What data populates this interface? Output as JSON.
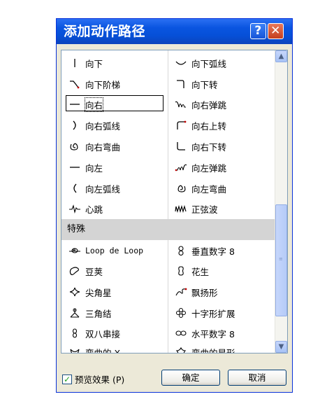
{
  "window": {
    "title": "添加动作路径",
    "help_symbol": "?",
    "close_symbol": "✕"
  },
  "list": {
    "basic_left": [
      {
        "label": "向下",
        "icon": "line-down-icon"
      },
      {
        "label": "向下阶梯",
        "icon": "step-down-icon"
      },
      {
        "label": "向右",
        "icon": "line-right-icon",
        "selected": true
      },
      {
        "label": "向右弧线",
        "icon": "arc-right-icon"
      },
      {
        "label": "向右弯曲",
        "icon": "curve-right-icon"
      },
      {
        "label": "向左",
        "icon": "line-left-icon"
      },
      {
        "label": "向左弧线",
        "icon": "arc-left-icon"
      },
      {
        "label": "心跳",
        "icon": "heartbeat-icon"
      }
    ],
    "basic_right": [
      {
        "label": "向下弧线",
        "icon": "arc-down-icon"
      },
      {
        "label": "向下转",
        "icon": "turn-down-icon"
      },
      {
        "label": "向右弹跳",
        "icon": "bounce-right-icon"
      },
      {
        "label": "向右上转",
        "icon": "turn-up-right-icon"
      },
      {
        "label": "向右下转",
        "icon": "turn-down-right-icon"
      },
      {
        "label": "向左弹跳",
        "icon": "bounce-left-icon"
      },
      {
        "label": "向左弯曲",
        "icon": "curve-left-icon"
      },
      {
        "label": "正弦波",
        "icon": "sine-wave-icon"
      }
    ],
    "section_special": "特殊",
    "special_left": [
      {
        "label": "Loop de Loop",
        "icon": "loop-icon"
      },
      {
        "label": "豆荚",
        "icon": "bean-icon"
      },
      {
        "label": "尖角星",
        "icon": "pointed-star-icon"
      },
      {
        "label": "三角结",
        "icon": "triangle-knot-icon"
      },
      {
        "label": "双八串接",
        "icon": "double-eight-icon"
      },
      {
        "label": "弯曲的 X",
        "icon": "curvy-x-icon"
      }
    ],
    "special_right": [
      {
        "label": "垂直数字 8",
        "icon": "vertical-eight-icon"
      },
      {
        "label": "花生",
        "icon": "peanut-icon"
      },
      {
        "label": "飘扬形",
        "icon": "flutter-icon"
      },
      {
        "label": "十字形扩展",
        "icon": "cross-expand-icon"
      },
      {
        "label": "水平数字 8",
        "icon": "horizontal-eight-icon"
      },
      {
        "label": "弯曲的星形",
        "icon": "curvy-star-icon"
      }
    ]
  },
  "preview": {
    "label": "预览效果 (P)",
    "checked": true
  },
  "buttons": {
    "ok": "确定",
    "cancel": "取消"
  },
  "colors": {
    "title_bar": "#0a55e0",
    "close_red": "#c53e1e",
    "section_bg": "#d4d4d4",
    "path_red": "#c00000"
  }
}
